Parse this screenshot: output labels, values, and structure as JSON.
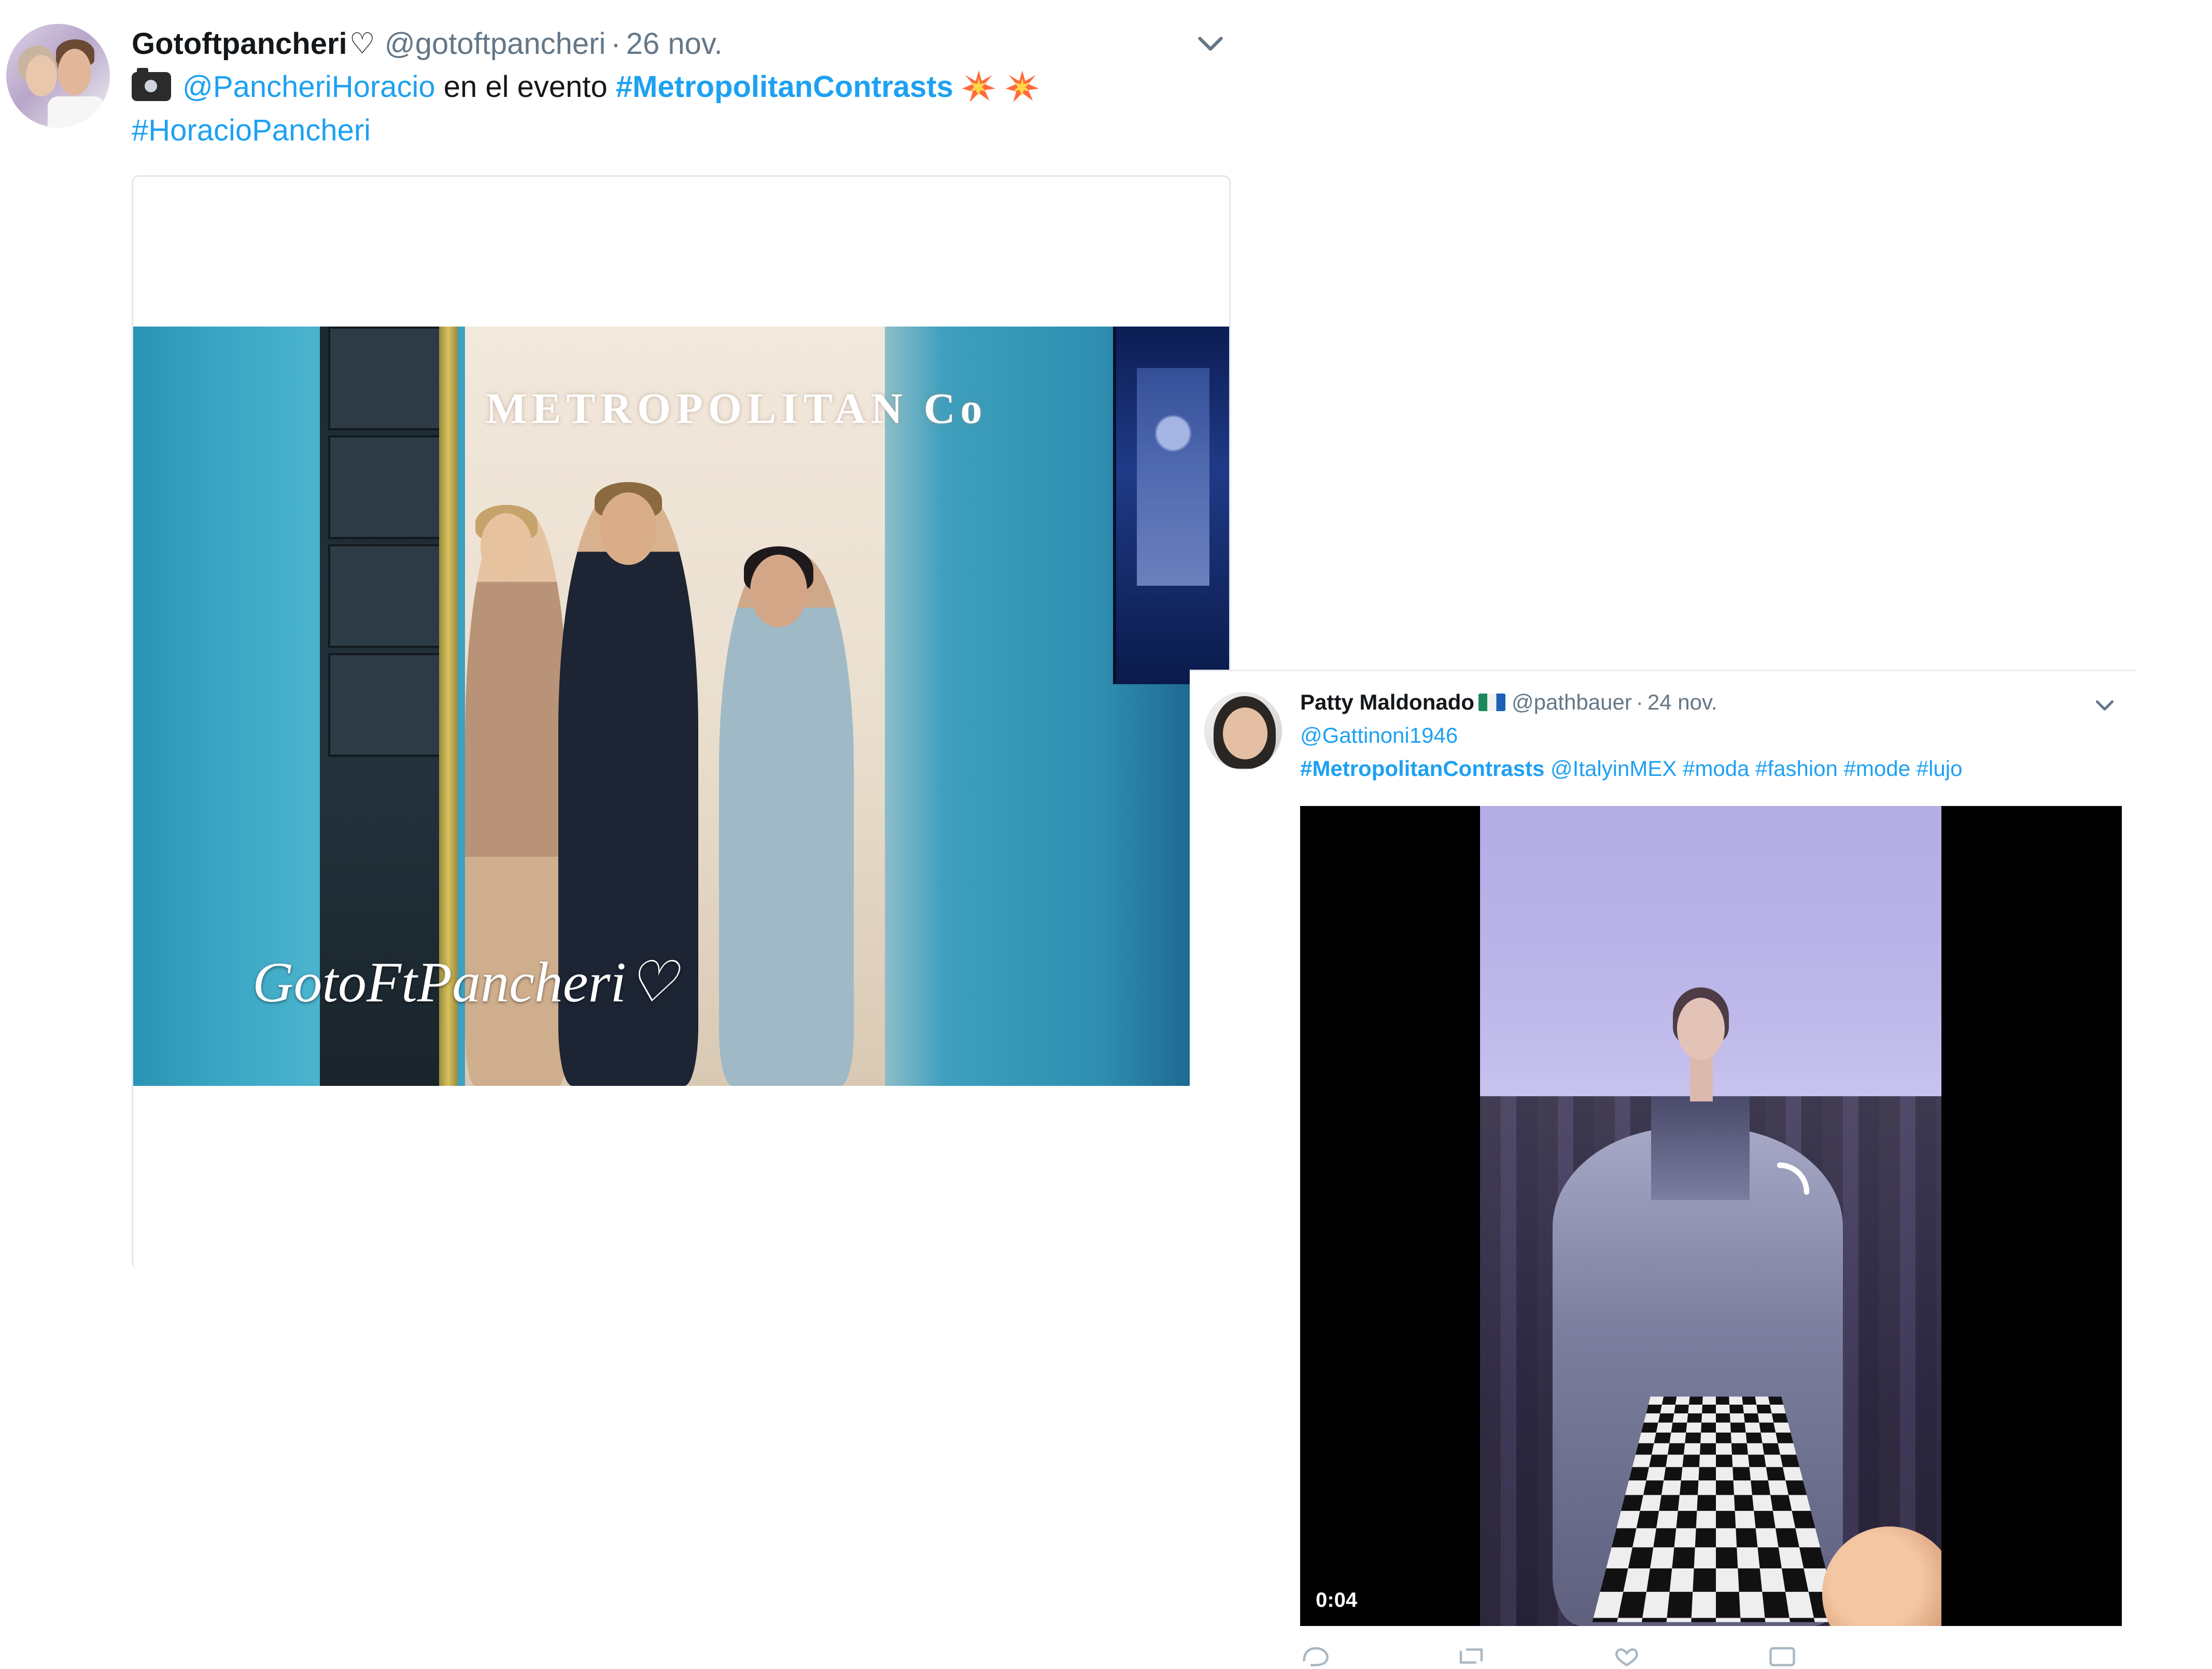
{
  "tweet1": {
    "author_name": "Gotoftpancheri",
    "author_suffix": "♡",
    "handle": "@gotoftpancheri",
    "separator": "·",
    "date": "26 nov.",
    "mention": "@PancheriHoracio",
    "text_middle": " en el evento ",
    "hashtag_main": "#MetropolitanContrasts",
    "hashtag_second": "#HoracioPancheri",
    "photo_backdrop_text": "METROPOLITAN Co",
    "photo_watermark": "GotoFtPancheri♡"
  },
  "tweet2": {
    "author_name": "Patty Maldonado",
    "handle": "@pathbauer",
    "separator": "·",
    "date": "24 nov.",
    "line1": "@Gattinoni1946",
    "hashtag_main": "#MetropolitanContrasts",
    "line2_rest": " @ItalyinMEX #moda #fashion #mode #lujo",
    "video_duration": "0:04"
  },
  "icons": {
    "caret": "chevron-down-icon",
    "camera": "camera-emoji-icon",
    "burst": "collision-emoji-icon",
    "flag": "flag-emoji-icon"
  },
  "colors": {
    "link": "#1da1f2",
    "text": "#14171a",
    "muted": "#657786",
    "border": "#e1e8ed"
  }
}
